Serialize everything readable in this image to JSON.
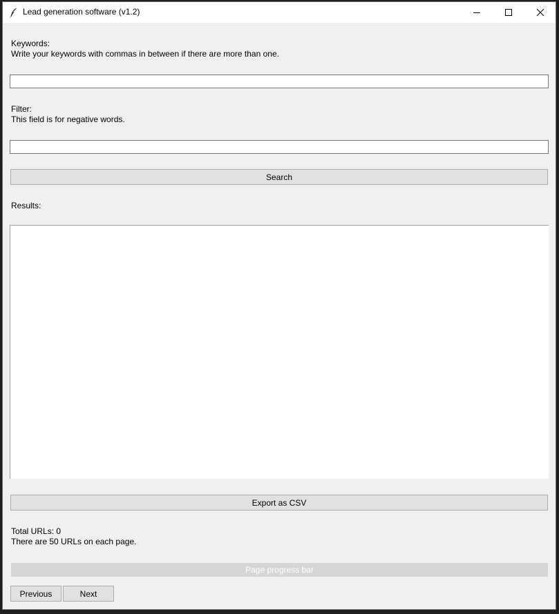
{
  "window": {
    "title": "Lead generation software (v1.2)"
  },
  "keywords": {
    "label": "Keywords:",
    "hint": "Write your keywords with commas in between if there are more than one.",
    "value": ""
  },
  "filter": {
    "label": "Filter:",
    "hint": "This field is for negative words.",
    "value": ""
  },
  "search_button": "Search",
  "results": {
    "label": "Results:",
    "content": ""
  },
  "export_button": "Export as CSV",
  "stats": {
    "total_urls": "Total URLs: 0",
    "per_page": "There are 50 URLs on each page."
  },
  "progress": {
    "label": "Page progress bar",
    "value": 0
  },
  "pagination": {
    "previous": "Previous",
    "next": "Next"
  },
  "colors": {
    "window_bg": "#f0f0f0",
    "button_bg": "#e1e1e1",
    "progress_trough": "#d6d6d6"
  },
  "icons": [
    "feather-icon",
    "minimize-icon",
    "maximize-icon",
    "close-icon"
  ]
}
